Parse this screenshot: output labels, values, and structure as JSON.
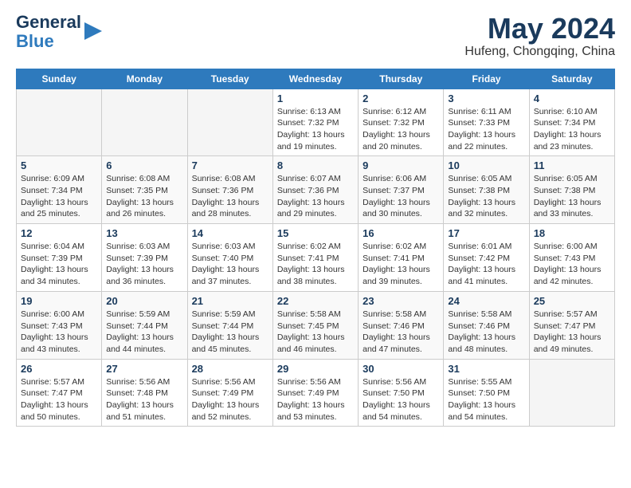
{
  "header": {
    "logo_line1": "General",
    "logo_line2": "Blue",
    "title": "May 2024",
    "subtitle": "Hufeng, Chongqing, China"
  },
  "days_of_week": [
    "Sunday",
    "Monday",
    "Tuesday",
    "Wednesday",
    "Thursday",
    "Friday",
    "Saturday"
  ],
  "weeks": [
    [
      {
        "date": "",
        "info": ""
      },
      {
        "date": "",
        "info": ""
      },
      {
        "date": "",
        "info": ""
      },
      {
        "date": "1",
        "info": "Sunrise: 6:13 AM\nSunset: 7:32 PM\nDaylight: 13 hours and 19 minutes."
      },
      {
        "date": "2",
        "info": "Sunrise: 6:12 AM\nSunset: 7:32 PM\nDaylight: 13 hours and 20 minutes."
      },
      {
        "date": "3",
        "info": "Sunrise: 6:11 AM\nSunset: 7:33 PM\nDaylight: 13 hours and 22 minutes."
      },
      {
        "date": "4",
        "info": "Sunrise: 6:10 AM\nSunset: 7:34 PM\nDaylight: 13 hours and 23 minutes."
      }
    ],
    [
      {
        "date": "5",
        "info": "Sunrise: 6:09 AM\nSunset: 7:34 PM\nDaylight: 13 hours and 25 minutes."
      },
      {
        "date": "6",
        "info": "Sunrise: 6:08 AM\nSunset: 7:35 PM\nDaylight: 13 hours and 26 minutes."
      },
      {
        "date": "7",
        "info": "Sunrise: 6:08 AM\nSunset: 7:36 PM\nDaylight: 13 hours and 28 minutes."
      },
      {
        "date": "8",
        "info": "Sunrise: 6:07 AM\nSunset: 7:36 PM\nDaylight: 13 hours and 29 minutes."
      },
      {
        "date": "9",
        "info": "Sunrise: 6:06 AM\nSunset: 7:37 PM\nDaylight: 13 hours and 30 minutes."
      },
      {
        "date": "10",
        "info": "Sunrise: 6:05 AM\nSunset: 7:38 PM\nDaylight: 13 hours and 32 minutes."
      },
      {
        "date": "11",
        "info": "Sunrise: 6:05 AM\nSunset: 7:38 PM\nDaylight: 13 hours and 33 minutes."
      }
    ],
    [
      {
        "date": "12",
        "info": "Sunrise: 6:04 AM\nSunset: 7:39 PM\nDaylight: 13 hours and 34 minutes."
      },
      {
        "date": "13",
        "info": "Sunrise: 6:03 AM\nSunset: 7:39 PM\nDaylight: 13 hours and 36 minutes."
      },
      {
        "date": "14",
        "info": "Sunrise: 6:03 AM\nSunset: 7:40 PM\nDaylight: 13 hours and 37 minutes."
      },
      {
        "date": "15",
        "info": "Sunrise: 6:02 AM\nSunset: 7:41 PM\nDaylight: 13 hours and 38 minutes."
      },
      {
        "date": "16",
        "info": "Sunrise: 6:02 AM\nSunset: 7:41 PM\nDaylight: 13 hours and 39 minutes."
      },
      {
        "date": "17",
        "info": "Sunrise: 6:01 AM\nSunset: 7:42 PM\nDaylight: 13 hours and 41 minutes."
      },
      {
        "date": "18",
        "info": "Sunrise: 6:00 AM\nSunset: 7:43 PM\nDaylight: 13 hours and 42 minutes."
      }
    ],
    [
      {
        "date": "19",
        "info": "Sunrise: 6:00 AM\nSunset: 7:43 PM\nDaylight: 13 hours and 43 minutes."
      },
      {
        "date": "20",
        "info": "Sunrise: 5:59 AM\nSunset: 7:44 PM\nDaylight: 13 hours and 44 minutes."
      },
      {
        "date": "21",
        "info": "Sunrise: 5:59 AM\nSunset: 7:44 PM\nDaylight: 13 hours and 45 minutes."
      },
      {
        "date": "22",
        "info": "Sunrise: 5:58 AM\nSunset: 7:45 PM\nDaylight: 13 hours and 46 minutes."
      },
      {
        "date": "23",
        "info": "Sunrise: 5:58 AM\nSunset: 7:46 PM\nDaylight: 13 hours and 47 minutes."
      },
      {
        "date": "24",
        "info": "Sunrise: 5:58 AM\nSunset: 7:46 PM\nDaylight: 13 hours and 48 minutes."
      },
      {
        "date": "25",
        "info": "Sunrise: 5:57 AM\nSunset: 7:47 PM\nDaylight: 13 hours and 49 minutes."
      }
    ],
    [
      {
        "date": "26",
        "info": "Sunrise: 5:57 AM\nSunset: 7:47 PM\nDaylight: 13 hours and 50 minutes."
      },
      {
        "date": "27",
        "info": "Sunrise: 5:56 AM\nSunset: 7:48 PM\nDaylight: 13 hours and 51 minutes."
      },
      {
        "date": "28",
        "info": "Sunrise: 5:56 AM\nSunset: 7:49 PM\nDaylight: 13 hours and 52 minutes."
      },
      {
        "date": "29",
        "info": "Sunrise: 5:56 AM\nSunset: 7:49 PM\nDaylight: 13 hours and 53 minutes."
      },
      {
        "date": "30",
        "info": "Sunrise: 5:56 AM\nSunset: 7:50 PM\nDaylight: 13 hours and 54 minutes."
      },
      {
        "date": "31",
        "info": "Sunrise: 5:55 AM\nSunset: 7:50 PM\nDaylight: 13 hours and 54 minutes."
      },
      {
        "date": "",
        "info": ""
      }
    ]
  ]
}
